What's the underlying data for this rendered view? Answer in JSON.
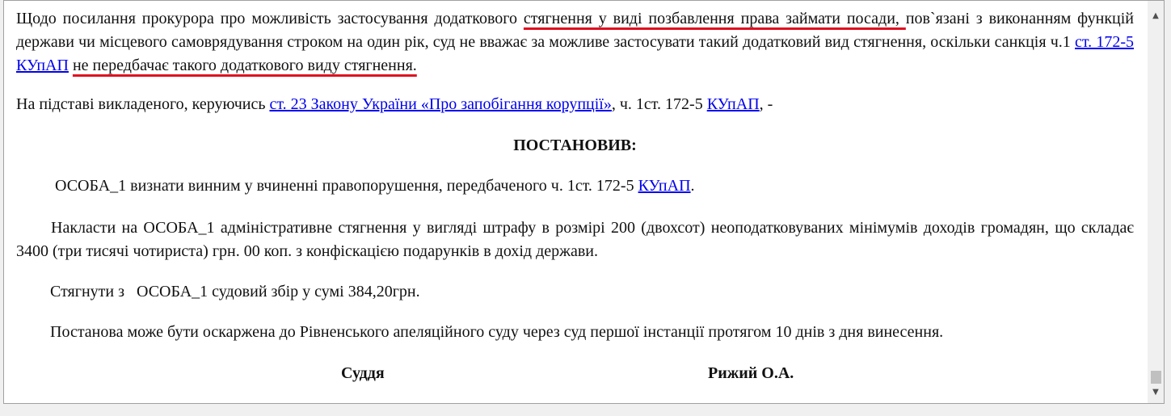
{
  "document": {
    "p1": {
      "t1": "Щодо посилання прокурора про можливість застосування додаткового ",
      "hl1": "стягнення у виді позбавлення права займати посади, ",
      "t2": "пов`язані з виконанням функцій держави чи місцевого самоврядування строком на один рік, суд не вважає за можливе застосувати такий додатковий вид стягнення, оскільки санкція ч.1 ",
      "link1": "ст. 172-5 КУпАП",
      "t3": " ",
      "hl2": "не передбачає такого додаткового виду стягнення.",
      "t4": ""
    },
    "p2": {
      "t1": "На підставі викладеного, керуючись ",
      "link1": "ст. 23 Закону України «Про запобігання корупції»",
      "t2": ", ч. 1ст. 172-5 ",
      "link2": "КУпАП",
      "t3": ", -"
    },
    "heading": "ПОСТАНОВИВ:",
    "p4": {
      "t1": "ОСОБА_1 визнати винним у вчиненні правопорушення, передбаченого ч. 1ст. 172-5 ",
      "link1": "КУпАП",
      "t2": "."
    },
    "p5": "Накласти на ОСОБА_1 адміністративне стягнення у вигляді штрафу в розмірі 200 (двохсот) неоподатковуваних мінімумів доходів громадян, що складає 3400 (три тисячі чотириста) грн. 00 коп. з конфіскацією подарунків в дохід держави.",
    "p6": "Стягнути з   ОСОБА_1 судовий збір у сумі 384,20грн.",
    "p7": "Постанова може бути оскаржена до Рівненського апеляційного суду через суд першої інстанції протягом 10 днів з дня винесення.",
    "judge_title": "Суддя",
    "judge_name": "Рижий О.А."
  },
  "scrollbar": {
    "up_icon": "▲",
    "down_icon": "▼"
  },
  "colors": {
    "link": "#0000ee",
    "highlight_underline": "#e01020"
  }
}
